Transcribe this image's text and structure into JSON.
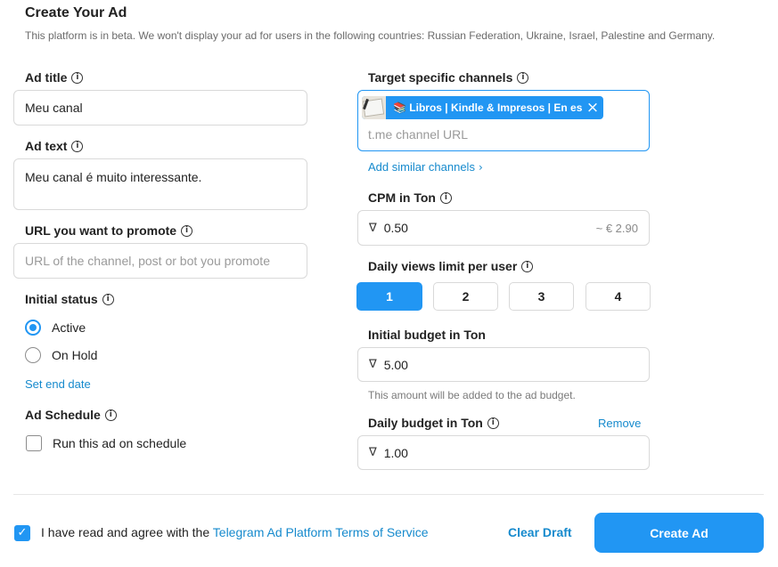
{
  "header": {
    "title": "Create Your Ad",
    "subtitle": "This platform is in beta. We won't display your ad for users in the following countries: Russian Federation, Ukraine, Israel, Palestine and Germany."
  },
  "left": {
    "ad_title": {
      "label": "Ad title",
      "value": "Meu canal"
    },
    "ad_text": {
      "label": "Ad text",
      "value": "Meu canal é muito interessante."
    },
    "url": {
      "label": "URL you want to promote",
      "placeholder": "URL of the channel, post or bot you promote"
    },
    "initial_status": {
      "label": "Initial status",
      "options": [
        {
          "label": "Active",
          "selected": true
        },
        {
          "label": "On Hold",
          "selected": false
        }
      ],
      "end_date_link": "Set end date"
    },
    "schedule": {
      "label": "Ad Schedule",
      "checkbox_label": "Run this ad on schedule",
      "checked": false
    }
  },
  "right": {
    "channels": {
      "label": "Target specific channels",
      "chip_label": "📚 Libros | Kindle & Impresos | En es...",
      "placeholder": "t.me channel URL",
      "similar_link": "Add similar channels"
    },
    "cpm": {
      "label": "CPM in Ton",
      "value": "0.50",
      "approx": "~ € 2.90"
    },
    "daily_views": {
      "label": "Daily views limit per user",
      "options": [
        "1",
        "2",
        "3",
        "4"
      ],
      "selected": "1"
    },
    "initial_budget": {
      "label": "Initial budget in Ton",
      "value": "5.00",
      "hint": "This amount will be added to the ad budget."
    },
    "daily_budget": {
      "label": "Daily budget in Ton",
      "remove_link": "Remove",
      "value": "1.00"
    }
  },
  "footer": {
    "agree_prefix": "I have read and agree with the ",
    "agree_link": "Telegram Ad Platform Terms of Service",
    "agree_checked": true,
    "clear_draft": "Clear Draft",
    "create_ad": "Create Ad"
  },
  "colors": {
    "accent": "#2196f3",
    "link": "#168acd",
    "border": "#d9d9d9"
  },
  "icons": {
    "info": "info-circle-icon",
    "ton": "ton-icon",
    "close": "close-icon",
    "chevron": "chevron-right-icon",
    "check": "check-icon"
  }
}
